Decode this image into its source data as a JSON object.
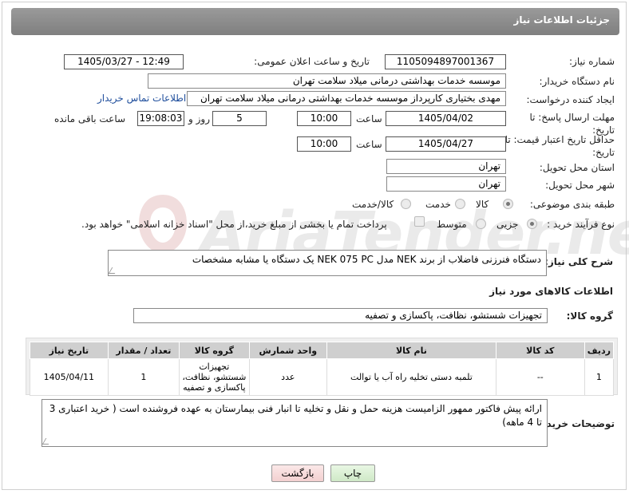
{
  "header": {
    "title": "جزئیات اطلاعات نیاز"
  },
  "form": {
    "need_number_label": "شماره نیاز:",
    "need_number": "1105094897001367",
    "announce_label": "تاریخ و ساعت اعلان عمومی:",
    "announce_value": "1405/03/27 - 12:49",
    "buyer_org_label": "نام دستگاه خریدار:",
    "buyer_org": "موسسه خدمات بهداشتی درمانی میلاد سلامت تهران",
    "creator_label": "ایجاد کننده درخواست:",
    "creator": "مهدی بختیاری کارپرداز موسسه خدمات بهداشتی درمانی میلاد سلامت تهران",
    "contact_link": "اطلاعات تماس خریدار",
    "deadline_label": "مهلت ارسال پاسخ: تا تاریخ:",
    "deadline_date": "1405/04/02",
    "hour_label": "ساعت",
    "deadline_time": "10:00",
    "days_value": "5",
    "days_label": "روز و",
    "remaining_time": "19:08:03",
    "remaining_label": "ساعت باقی مانده",
    "price_valid_label": "حداقل تاریخ اعتبار قیمت: تا تاریخ:",
    "price_valid_date": "1405/04/27",
    "price_valid_time": "10:00",
    "province_label": "استان محل تحویل:",
    "province": "تهران",
    "city_label": "شهر محل تحویل:",
    "city": "تهران",
    "category_label": "طبقه بندی موضوعی:",
    "category_options": [
      "کالا",
      "خدمت",
      "کالا/خدمت"
    ],
    "category_selected": "کالا",
    "process_label": "نوع فرآیند خرید :",
    "process_options": [
      "جزیی",
      "متوسط"
    ],
    "process_selected": "جزیی",
    "payment_note": "پرداخت تمام یا بخشی از مبلغ خرید،از محل \"اسناد خزانه اسلامی\" خواهد بود."
  },
  "general_desc": {
    "label": "شرح کلی نیاز:",
    "text": "دستگاه فنرزنی فاضلاب از برند NEK مدل NEK 075 PC یک دستگاه یا مشابه مشخصات"
  },
  "goods_info": {
    "title": "اطلاعات کالاهای مورد نیاز",
    "group_label": "گروه کالا:",
    "group_value": "تجهیزات شستشو، نظافت، پاکسازی و تصفیه"
  },
  "table": {
    "headers": [
      "ردیف",
      "کد کالا",
      "نام کالا",
      "واحد شمارش",
      "گروه کالا",
      "تعداد / مقدار",
      "تاریخ نیاز"
    ],
    "rows": [
      [
        "1",
        "--",
        "تلمبه دستی تخلیه راه آب یا توالت",
        "عدد",
        "تجهیزات شستشو، نظافت، پاکسازی و تصفیه",
        "1",
        "1405/04/11"
      ]
    ]
  },
  "buyer_notes": {
    "label": "توضیحات خریدار:",
    "text": "ارائه پیش فاکتور ممهور الزامیست هزینه حمل و نقل و تخلیه تا انبار فنی بیمارستان به عهده فروشنده است ( خرید اعتباری 3 تا 4 ماهه)"
  },
  "buttons": {
    "print": "چاپ",
    "back": "بازگشت"
  },
  "watermark": "AriaTender.net"
}
